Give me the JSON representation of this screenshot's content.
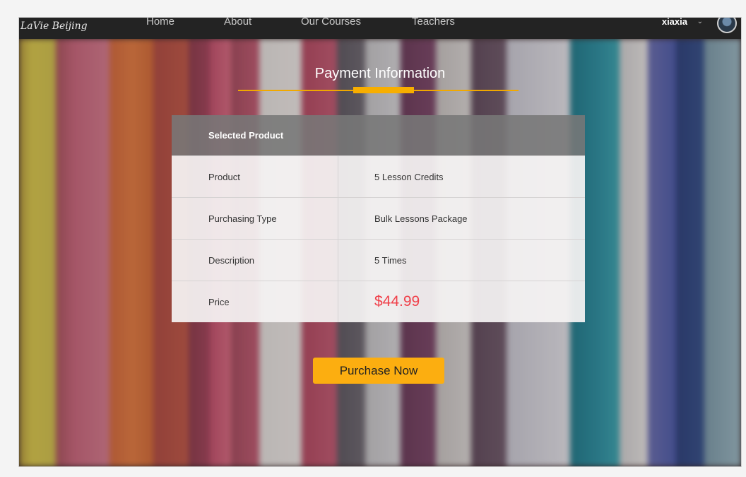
{
  "nav": {
    "logo": "LaVie Beijing",
    "items": [
      {
        "label": "Home"
      },
      {
        "label": "About"
      },
      {
        "label": "Our Courses"
      },
      {
        "label": "Teachers"
      }
    ],
    "user": {
      "name": "xiaxia"
    }
  },
  "page": {
    "title": "Payment Information"
  },
  "table": {
    "header": "Selected Product",
    "rows": [
      {
        "label": "Product",
        "value": "5 Lesson Credits"
      },
      {
        "label": "Purchasing Type",
        "value": "Bulk Lessons Package"
      },
      {
        "label": "Description",
        "value": "5 Times"
      },
      {
        "label": "Price",
        "value": "$44.99"
      }
    ]
  },
  "actions": {
    "purchase_label": "Purchase Now"
  },
  "colors": {
    "accent": "#f7ae00",
    "price": "#f0404a",
    "navbar": "#232323"
  }
}
